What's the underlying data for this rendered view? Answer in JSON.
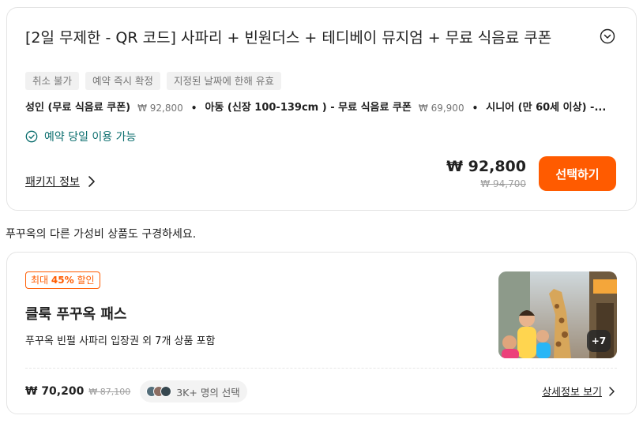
{
  "package_card": {
    "title": "[2일 무제한 - QR 코드] 사파리 + 빈원더스 + 테디베이 뮤지엄 + 무료 식음료 쿠폰",
    "tags": [
      "취소 불가",
      "예약 즉시 확정",
      "지정된 날짜에 한해 유효"
    ],
    "price_options": [
      {
        "name": "성인 (무료 식음료 쿠폰)",
        "price": "₩ 92,800"
      },
      {
        "name": "아동 (신장 100-139cm ) - 무료 식음료 쿠폰",
        "price": "₩ 69,900"
      },
      {
        "name": "시니어 (만 60세 이상) -...",
        "price": ""
      }
    ],
    "same_day_label": "예약 당일 이용 가능",
    "package_info_link": "패키지 정보",
    "price": "₩ 92,800",
    "original_price": "₩ 94,700",
    "select_button": "선택하기",
    "icons": {
      "expand": "chevron-down-circle-icon",
      "check": "check-circle-icon",
      "link_arrow": "chevron-right-icon"
    },
    "colors": {
      "accent": "#ff5b00",
      "same_day": "#0b6e6e"
    }
  },
  "section_heading": "푸꾸옥의 다른 가성비 상품도 구경하세요.",
  "pass_card": {
    "discount_prefix": "최대 ",
    "discount_value": "45%",
    "discount_suffix": " 할인",
    "title": "클룩 푸꾸옥 패스",
    "description": "푸꾸옥 빈펄 사파리 입장권 외 7개 상품 포함",
    "image_more_count": "+7",
    "price": "₩ 70,200",
    "original_price": "₩ 87,100",
    "social_proof": "3K+ 명의 선택",
    "detail_link": "상세정보 보기",
    "icons": {
      "image": "giraffe-safari-photo",
      "link_arrow": "chevron-right-icon",
      "avatars": "user-avatars-icon"
    }
  }
}
